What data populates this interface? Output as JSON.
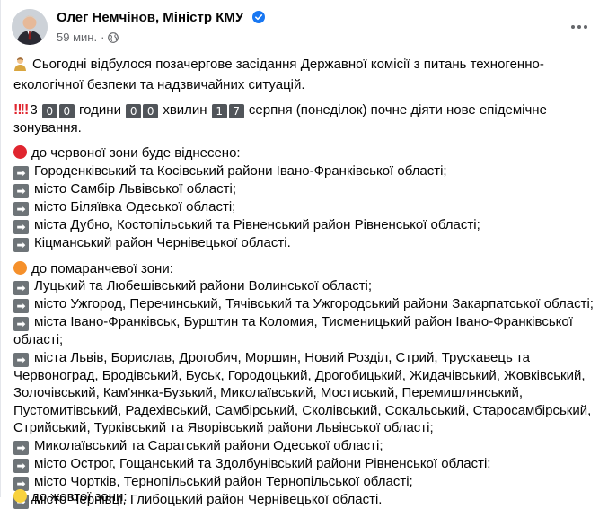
{
  "post": {
    "author": "Олег Немчінов, Міністр КМУ",
    "time": "59 мин.",
    "meta_sep": "·"
  },
  "text": {
    "intro": "Сьогодні відбулося позачергове засідання Державної комісії з питань техногенно-екологічної безпеки та надзвичайних ситуацій.",
    "countdown": {
      "prefix": "3",
      "d1": "0",
      "d2": "0",
      "w1": "години",
      "d3": "0",
      "d4": "0",
      "w2": "хвилин",
      "d5": "1",
      "d6": "7",
      "suffix": "серпня (понеділок) почне діяти нове епідемічне",
      "suffix2": "зонування."
    },
    "red_heading": "до червоної зони буде віднесено:",
    "red_items": [
      "Городенківський та Косівський райони Івано-Франківської області;",
      "місто Самбір Львівської області;",
      "місто Біляївка Одеської області;",
      "міста Дубно, Костопільський та Рівненський район Рівненської області;",
      "Кіцманський район Чернівецької області."
    ],
    "orange_heading": "до помаранчевої зони:",
    "orange_items": [
      [
        "Луцький та Любешівський райони Волинської області;"
      ],
      [
        "місто Ужгород, Перечинський, Тячівський та Ужгородський райони Закарпатської області;"
      ],
      [
        "міста Івано-Франківськ, Бурштин та Коломия, Тисменицький район Івано-Франківської",
        "області;"
      ],
      [
        "міста Львів, Борислав, Дрогобич, Моршин, Новий Розділ, Стрий, Трускавець та",
        "Червоноград, Бродівський, Буськ, Городоцький, Дрогобицький, Жидачівський, Жовківський,",
        "Золочівський, Кам'янка-Бузький, Миколаївський, Мостиський, Перемишлянський,",
        "Пустомитівський, Радехівський, Самбірський, Сколівський, Сокальський, Старосамбірський,",
        "Стрийський, Турківський та Яворівський райони Львівської області;"
      ],
      [
        "Миколаївський та Саратський райони Одеської області;"
      ],
      [
        "місто Острог, Гощанський та Здолбунівський райони Рівненської області;"
      ],
      [
        "місто Чортків, Тернопільський район Тернопільської області;"
      ],
      [
        "місто Чернівці, Глибоцький район Чернівецької області."
      ]
    ],
    "cut_line": "до жовтої зони:"
  },
  "colors": {
    "verified": "#1877f2",
    "meta": "#65676b",
    "red_dot": "#e0252f",
    "orange_dot": "#f5902b",
    "arrow_bg": "#6e7478"
  },
  "icons": {
    "verified": "verified-badge-icon",
    "audience": "globe-icon",
    "more": "more-options-icon",
    "intro": "person-icon",
    "arrows": "right-arrow-icon"
  }
}
